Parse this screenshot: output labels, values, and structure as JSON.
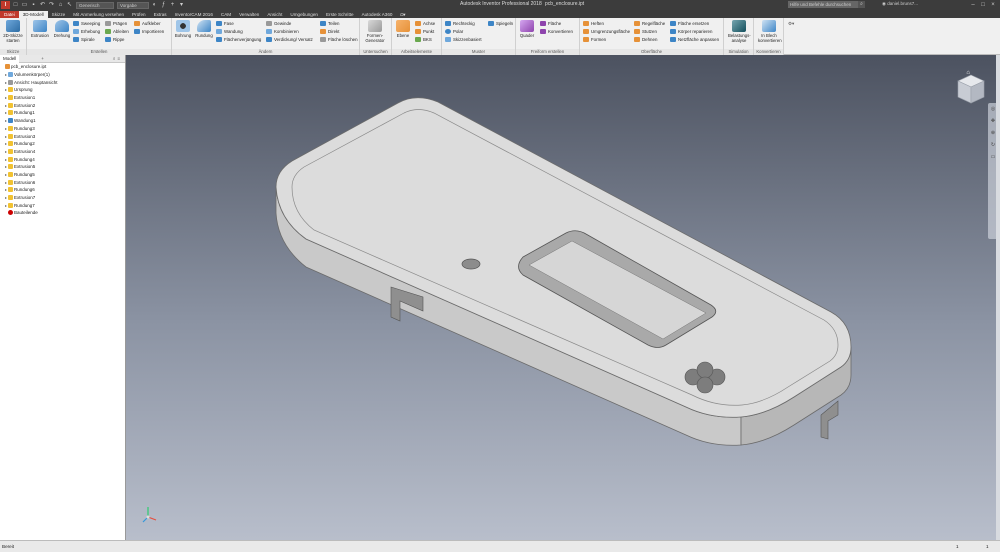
{
  "titlebar": {
    "app_title": "Autodesk Inventor Professional 2018",
    "doc_title": "pcb_enclosure.ipt",
    "material": "Generisch",
    "appearance": "Vorgabe",
    "search_placeholder": "Hilfe und Befehle durchsuchen",
    "user": "daniel.bruns7..."
  },
  "tabs": [
    "Datei",
    "3D-Modell",
    "Skizze",
    "Mit Anmerkung versehen",
    "Prüfen",
    "Extras",
    "InventorCAM 2016",
    "CAM",
    "Verwalten",
    "Ansicht",
    "Umgebungen",
    "Erste Schritte",
    "Autodesk A360"
  ],
  "ribbon": {
    "skizze": {
      "label": "Skizze",
      "start_line1": "2D-Skizze",
      "start_line2": "starten"
    },
    "erstellen": {
      "label": "Erstellen",
      "extrusion": "Extrusion",
      "drehung": "Drehung",
      "sweeping": "Sweeping",
      "erhebung": "Erhebung",
      "spirale": "Spirale",
      "prigen": "Prägen",
      "ableiten": "Ableiten",
      "rippe": "Rippe",
      "aufkleber": "Aufkleber",
      "importieren": "Importieren"
    },
    "aendern": {
      "label": "Ändern",
      "bohrung": "Bohrung",
      "rundung": "Rundung",
      "fase": "Fase",
      "wandung": "Wandung",
      "flaechenverjuengung": "Flächenverjüngung",
      "gewinde": "Gewinde",
      "kombinieren": "Kombinieren",
      "verdickung": "Verdickung/ Versatz",
      "teilen": "Teilen",
      "direkt": "Direkt",
      "flaeche_loeschen": "Fläche löschen"
    },
    "untersuchen": {
      "label": "Untersuchen",
      "formen_line1": "Formen-",
      "formen_line2": "Generator"
    },
    "arbeitselemente": {
      "label": "Arbeitselemente",
      "ebene": "Ebene",
      "achse": "Achse",
      "punkt": "Punkt",
      "bks": "BKS"
    },
    "muster": {
      "label": "Muster",
      "rechteckig": "Rechteckig",
      "polar": "Polar",
      "skizzenbasiert": "Skizzenbasiert",
      "spiegeln": "Spiegeln"
    },
    "freiform": {
      "label": "Freiform erstellen",
      "quader": "Quader",
      "flaeche": "Fläche",
      "konvertieren": "Konvertieren"
    },
    "oberflaeche": {
      "label": "Oberfläche",
      "heften": "Heften",
      "umgrenzungsflaeche": "Umgrenzungsfläche",
      "formen": "Formen",
      "regelflaeche": "Regelfläche",
      "stutzen": "Stutzen",
      "dehnen": "Dehnen",
      "flaeche_ersetzen": "Fläche ersetzen",
      "koerper_reparieren": "Körper reparieren",
      "netzflaeche": "Netzfläche anpassen"
    },
    "simulation": {
      "label": "Simulation",
      "line1": "Belastungs-",
      "line2": "analyse"
    },
    "konvertieren": {
      "label": "Konvertieren",
      "line1": "In Blech",
      "line2": "konvertieren"
    }
  },
  "browser": {
    "tab": "Modell",
    "items": [
      {
        "label": "pcb_enclosure.ipt",
        "icon": "part-icon",
        "indent": 0
      },
      {
        "label": "Volumenkörper(1)",
        "icon": "solid-bodies-icon",
        "indent": 1
      },
      {
        "label": "Ansicht: Hauptansicht",
        "icon": "view-icon",
        "indent": 1
      },
      {
        "label": "Ursprung",
        "icon": "origin-folder-icon",
        "indent": 1
      },
      {
        "label": "Extrusion1",
        "icon": "extrusion-icon",
        "indent": 1
      },
      {
        "label": "Extrusion2",
        "icon": "extrusion-icon",
        "indent": 1
      },
      {
        "label": "Rundung1",
        "icon": "fillet-icon",
        "indent": 1
      },
      {
        "label": "Wandung1",
        "icon": "shell-icon",
        "indent": 1
      },
      {
        "label": "Rundung3",
        "icon": "fillet-icon",
        "indent": 1
      },
      {
        "label": "Extrusion3",
        "icon": "extrusion-icon",
        "indent": 1
      },
      {
        "label": "Rundung2",
        "icon": "fillet-icon",
        "indent": 1
      },
      {
        "label": "Extrusion4",
        "icon": "extrusion-icon",
        "indent": 1
      },
      {
        "label": "Rundung4",
        "icon": "fillet-icon",
        "indent": 1
      },
      {
        "label": "Extrusion5",
        "icon": "extrusion-icon",
        "indent": 1
      },
      {
        "label": "Rundung5",
        "icon": "fillet-icon",
        "indent": 1
      },
      {
        "label": "Extrusion6",
        "icon": "extrusion-icon",
        "indent": 1
      },
      {
        "label": "Rundung6",
        "icon": "fillet-icon",
        "indent": 1
      },
      {
        "label": "Extrusion7",
        "icon": "extrusion-icon",
        "indent": 1
      },
      {
        "label": "Rundung7",
        "icon": "fillet-icon",
        "indent": 1
      },
      {
        "label": "Bauteilende",
        "icon": "end-of-part-icon",
        "indent": 1
      }
    ]
  },
  "status": {
    "text": "Bereit",
    "n1": "1",
    "n2": "1"
  },
  "colors": {
    "file_tab": "#c0392b",
    "viewport_top": "#4c5260",
    "viewport_bottom": "#b8becb",
    "model_fill": "#dcdcdc"
  }
}
